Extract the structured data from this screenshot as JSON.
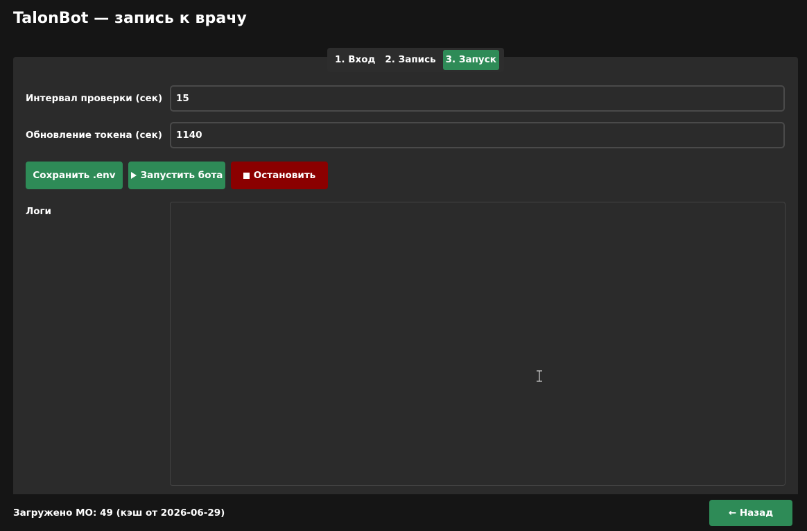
{
  "window": {
    "title": "TalonBot — запись к врачу"
  },
  "tabs": [
    {
      "label": "1. Вход",
      "active": false
    },
    {
      "label": "2. Запись",
      "active": false
    },
    {
      "label": "3. Запуск",
      "active": true
    }
  ],
  "form": {
    "interval_label": "Интервал проверки (сек)",
    "interval_value": "15",
    "token_label": "Обновление токена (сек)",
    "token_value": "1140",
    "logs_label": "Логи",
    "logs_value": ""
  },
  "buttons": {
    "save_env": "Сохранить .env",
    "start_bot": "Запустить бота",
    "stop": "Остановить",
    "back": "← Назад"
  },
  "status": {
    "text": "Загружено МО: 49 (кэш от 2026-06-29)"
  },
  "colors": {
    "accent": "#2e8b57",
    "danger": "#8b0000",
    "background": "#151515",
    "panel": "#2b2b2b"
  },
  "icons": {
    "start": "play-icon",
    "stop": "stop-icon",
    "cursor": "text-cursor-icon"
  }
}
